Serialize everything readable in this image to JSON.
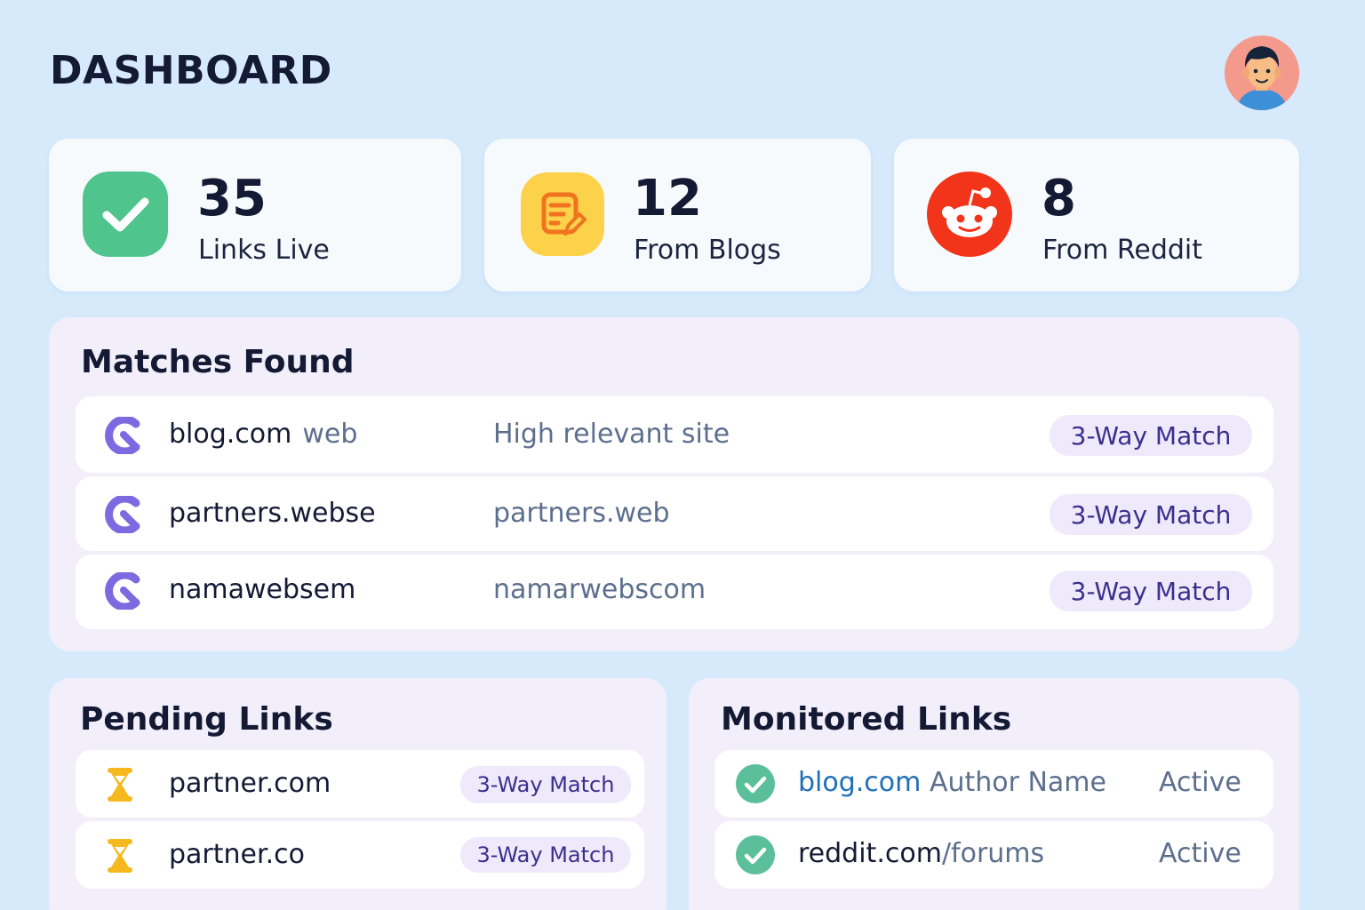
{
  "header": {
    "title": "DASHBOARD",
    "avatar_icon": "user-avatar"
  },
  "stats": [
    {
      "value": "35",
      "label": "Links Live",
      "icon": "check-icon",
      "color": "#4fc58d"
    },
    {
      "value": "12",
      "label": "From Blogs",
      "icon": "blog-note-icon",
      "color": "#fcd24a"
    },
    {
      "value": "8",
      "label": "From Reddit",
      "icon": "reddit-icon",
      "color": "#f1341a"
    }
  ],
  "matches": {
    "title": "Matches Found",
    "rows": [
      {
        "domain": "blog.com",
        "sub": "web",
        "desc": "High relevant site",
        "badge": "3-Way Match"
      },
      {
        "domain": "partners.webse",
        "sub": "",
        "desc": "partners.web",
        "badge": "3-Way Match"
      },
      {
        "domain": "namawebsem",
        "sub": "",
        "desc": "namarwebscom",
        "badge": "3-Way Match"
      }
    ]
  },
  "pending": {
    "title": "Pending Links",
    "rows": [
      {
        "domain": "partner.com",
        "badge": "3-Way Match",
        "icon": "hourglass-icon"
      },
      {
        "domain": "partner.co",
        "badge": "3-Way Match",
        "icon": "hourglass-icon"
      }
    ]
  },
  "monitored": {
    "title": "Monitored Links",
    "rows": [
      {
        "domain": "blog.com",
        "extra": "Author Name",
        "status": "Active",
        "icon": "check-circle-icon"
      },
      {
        "domain": "reddit.com",
        "extra": "/forums",
        "status": "Active",
        "icon": "check-circle-icon"
      }
    ]
  },
  "colors": {
    "background": "#d6eafc",
    "badge_bg": "#efeafb",
    "badge_text": "#3b2f8e",
    "match_icon": "#7d6ae0",
    "hourglass": "#f5b81f",
    "active_check": "#5bbf9c"
  }
}
